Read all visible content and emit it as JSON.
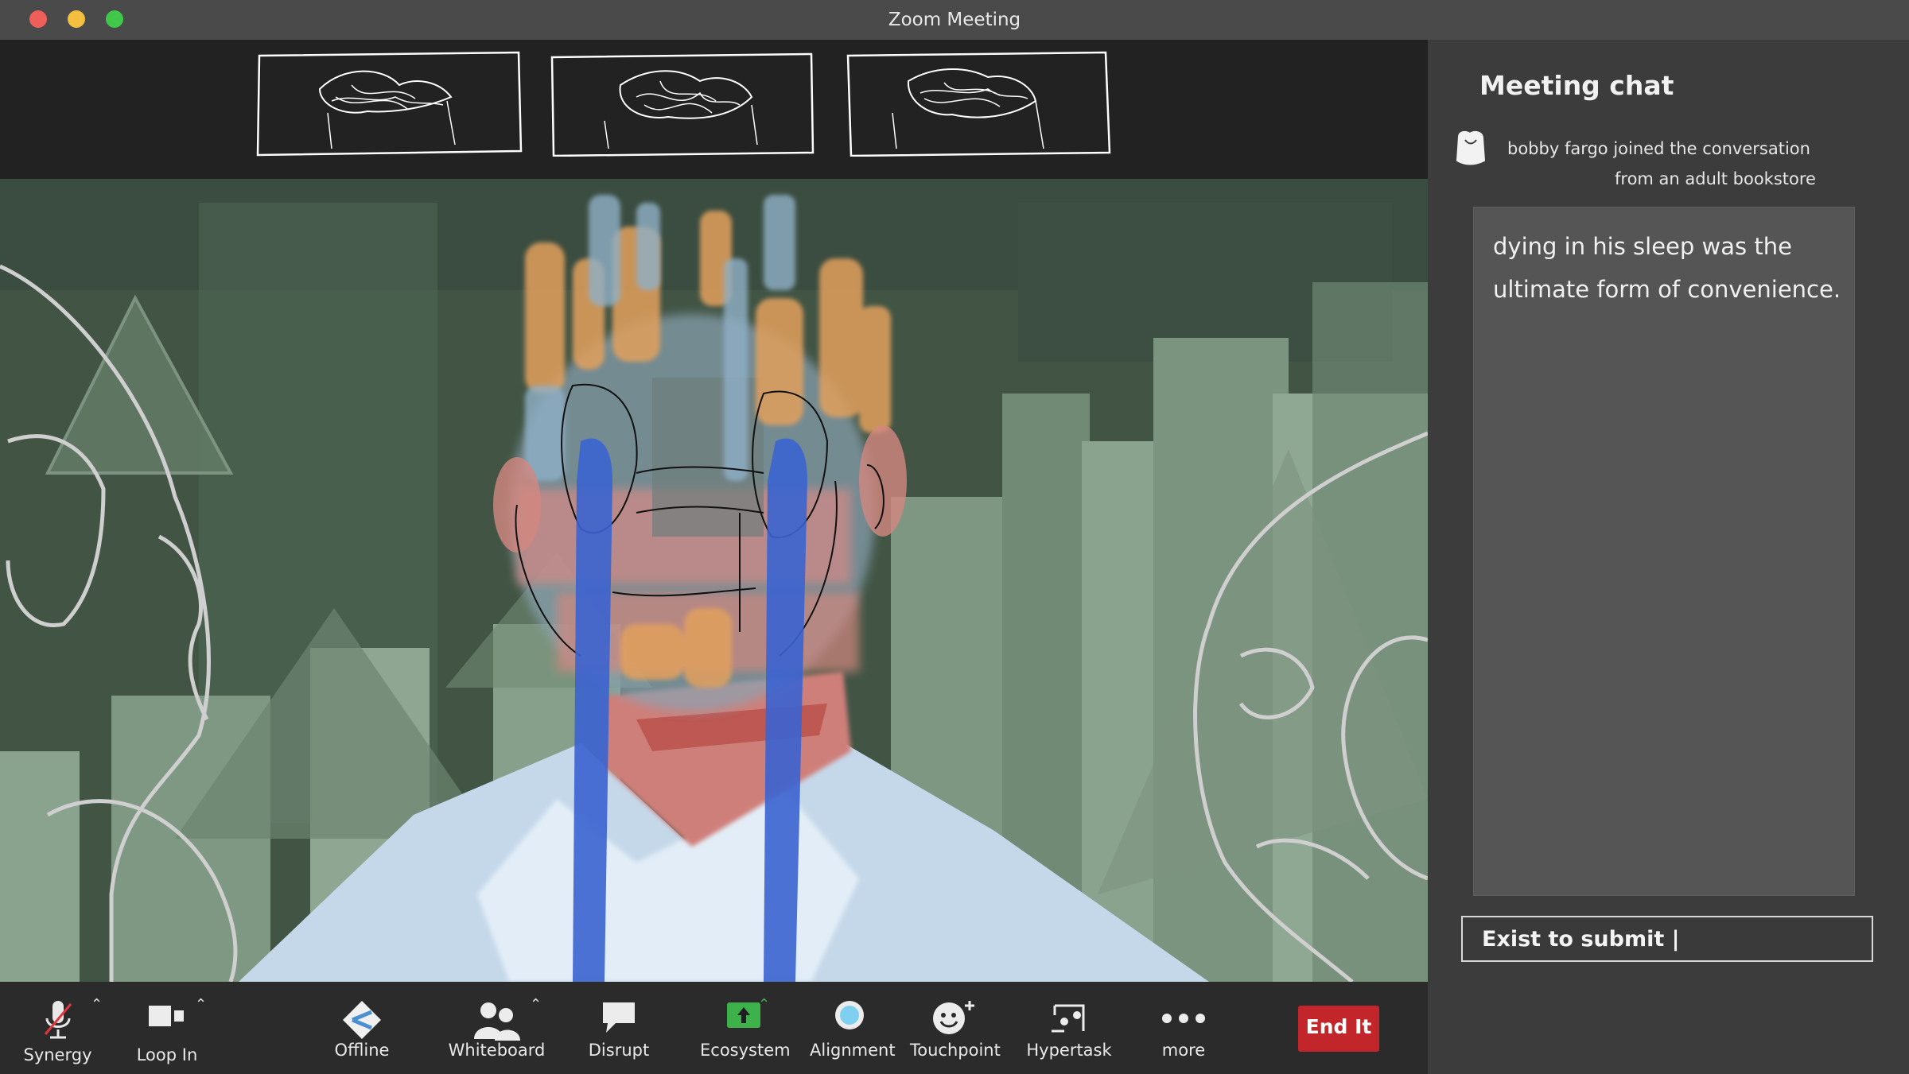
{
  "window": {
    "title": "Zoom Meeting"
  },
  "chat": {
    "title": "Meeting chat",
    "system_line1": "bobby fargo  joined the conversation",
    "system_line2": "from an adult bookstore",
    "message": "dying in his sleep was the ultimate form of convenience.",
    "input_value": "Exist to submit |"
  },
  "toolbar": {
    "synergy": "Synergy",
    "loop_in": "Loop In",
    "offline": "Offline",
    "whiteboard": "Whiteboard",
    "disrupt": "Disrupt",
    "ecosystem": "Ecosystem",
    "alignment": "Alignment",
    "touchpoint": "Touchpoint",
    "hypertask": "Hypertask",
    "more": "more",
    "end": "End It"
  },
  "colors": {
    "end_button": "#c2262a",
    "ecosystem_icon": "#3db14a",
    "alignment_icon": "#7fd0f0",
    "video_green": "#46594a",
    "tear_blue": "#3b63d0"
  }
}
